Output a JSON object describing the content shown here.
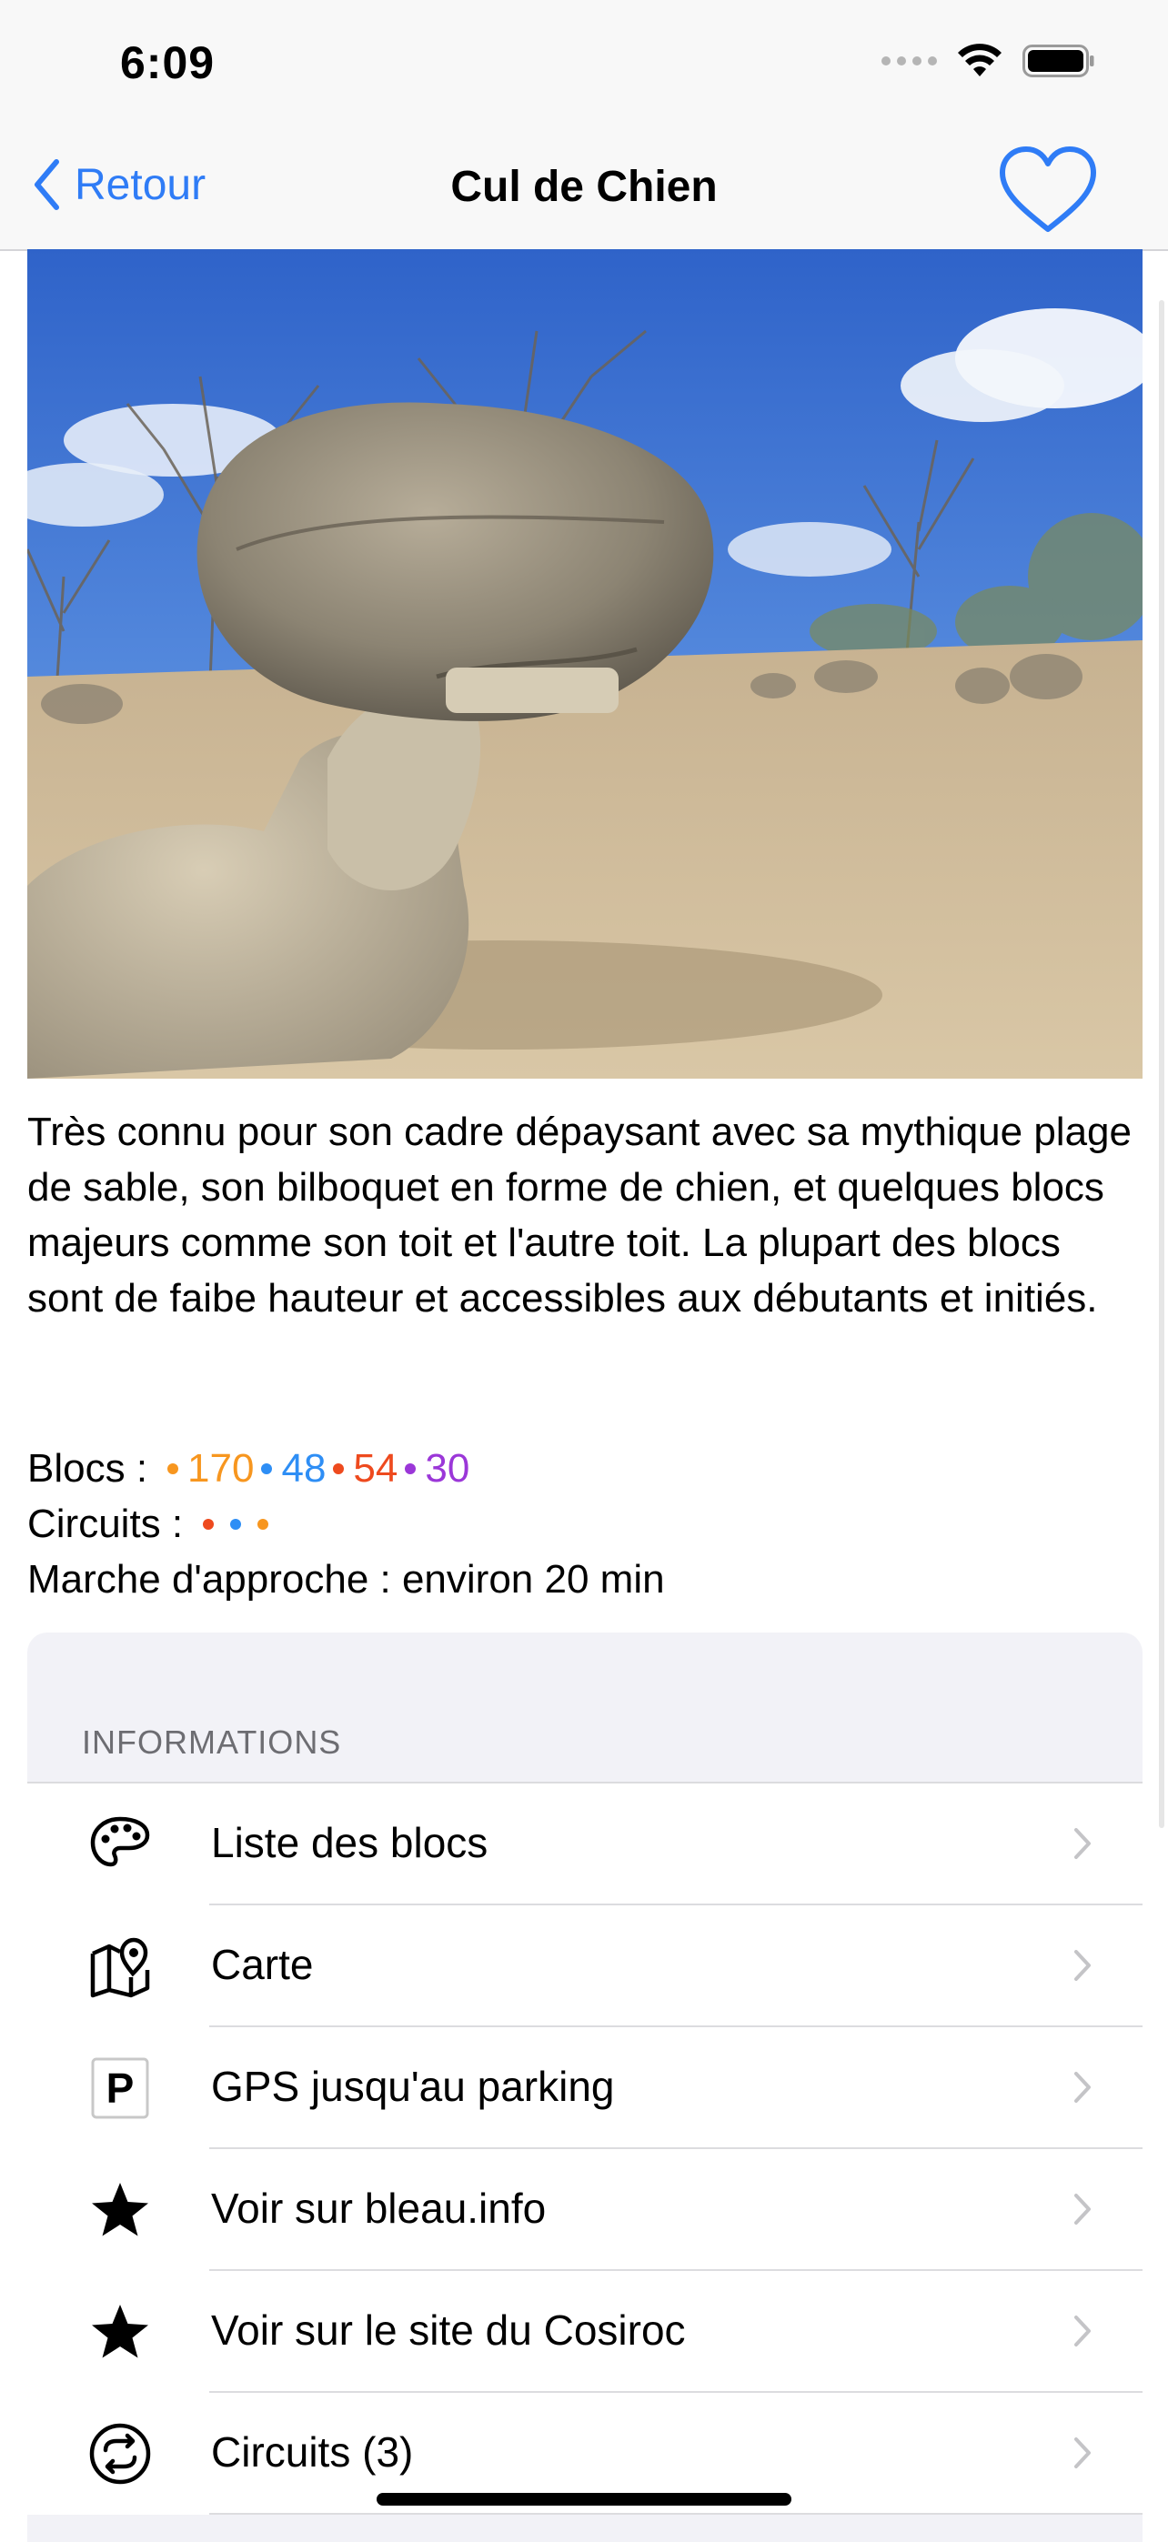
{
  "status_bar": {
    "time": "6:09"
  },
  "nav": {
    "back_label": "Retour",
    "title": "Cul de Chien"
  },
  "description": "Très connu pour son cadre dépaysant avec sa mythique plage de sable, son bilboquet en forme de chien, et quelques blocs majeurs comme son toit et l'autre toit. La plupart des blocs sont de faibe hauteur et accessibles aux débutants et initiés.",
  "blocs": {
    "label": "Blocs :",
    "counts": [
      {
        "value": "170",
        "color": "#f7961f"
      },
      {
        "value": "48",
        "color": "#2e8ef5"
      },
      {
        "value": "54",
        "color": "#ee4a1e"
      },
      {
        "value": "30",
        "color": "#9b37d8"
      }
    ]
  },
  "circuits": {
    "label": "Circuits :",
    "colors": [
      "#ee4a1e",
      "#2e8ef5",
      "#f7961f"
    ]
  },
  "approach": "Marche d'approche : environ 20 min",
  "info": {
    "header": "INFORMATIONS",
    "items": [
      {
        "label": "Liste des blocs",
        "icon": "palette-icon"
      },
      {
        "label": "Carte",
        "icon": "map-pin-icon"
      },
      {
        "label": "GPS jusqu'au parking",
        "icon": "parking-icon"
      },
      {
        "label": "Voir sur bleau.info",
        "icon": "star-icon"
      },
      {
        "label": "Voir sur le site du Cosiroc",
        "icon": "star-icon"
      },
      {
        "label": "Circuits (3)",
        "icon": "circuit-arrows-icon"
      }
    ]
  },
  "colors": {
    "accent": "#2f7cf6"
  }
}
